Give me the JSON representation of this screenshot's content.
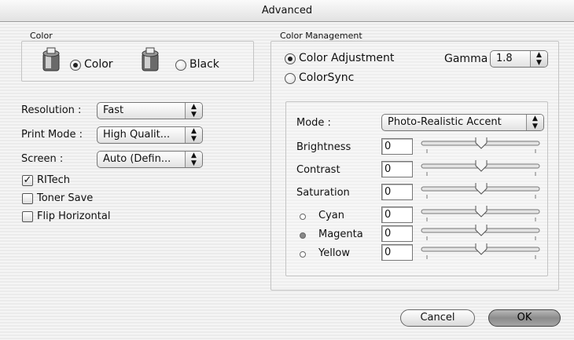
{
  "window": {
    "title": "Advanced"
  },
  "color_group": {
    "label": "Color",
    "color_option": "Color",
    "black_option": "Black",
    "selected": "Color"
  },
  "settings": [
    {
      "label": "Resolution :",
      "value": "Fast"
    },
    {
      "label": "Print Mode :",
      "value": "High Qualit..."
    },
    {
      "label": "Screen :",
      "value": "Auto (Defin..."
    }
  ],
  "checkboxes": [
    {
      "label": "RITech",
      "checked": true
    },
    {
      "label": "Toner Save",
      "checked": false
    },
    {
      "label": "Flip Horizontal",
      "checked": false
    }
  ],
  "color_management": {
    "label": "Color Management",
    "adjustment_option": "Color Adjustment",
    "colorsync_option": "ColorSync",
    "selected": "Color Adjustment",
    "gamma_label": "Gamma",
    "gamma_value": "1.8",
    "mode_label": "Mode :",
    "mode_value": "Photo-Realistic Accent",
    "sliders": [
      {
        "label": "Brightness",
        "value": "0",
        "level": 0.5
      },
      {
        "label": "Contrast",
        "value": "0",
        "level": 0.5
      },
      {
        "label": "Saturation",
        "value": "0",
        "level": 0.5
      },
      {
        "label": "Cyan",
        "value": "0",
        "level": 0.5,
        "swatch": "empty"
      },
      {
        "label": "Magenta",
        "value": "0",
        "level": 0.5,
        "swatch": "filled"
      },
      {
        "label": "Yellow",
        "value": "0",
        "level": 0.5,
        "swatch": "empty"
      }
    ]
  },
  "buttons": {
    "cancel": "Cancel",
    "ok": "OK"
  }
}
